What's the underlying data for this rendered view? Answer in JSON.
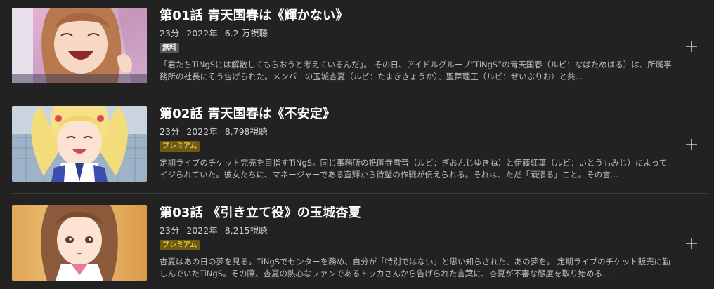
{
  "episodes": [
    {
      "title": "第01話 青天国春は《輝かない》",
      "duration": "23分",
      "year": "2022年",
      "views": "6.2 万視聴",
      "badge": "無料",
      "badge_type": "free",
      "description": "「君たちTiNgSには解散してもらおうと考えているんだ」。 その日、アイドルグループ”TiNgS”の青天国春（ルビ：なばためはる）は、所属事務所の社長にそう告げられた。メンバーの玉城杏夏（ルビ：たまききょうか）、聖舞理王（ルビ：せいぶりお）と共..."
    },
    {
      "title": "第02話 青天国春は《不安定》",
      "duration": "23分",
      "year": "2022年",
      "views": "8,798視聴",
      "badge": "プレミアム",
      "badge_type": "premium",
      "description": "定期ライブのチケット完売を目指すTiNgS。同じ事務所の祇園寺雪音（ルビ：ぎおんじゆきね）と伊藤紅葉（ルビ：いとうもみじ）によってイジられていた。彼女たちに、マネージャーである直輝から待望の作戦が伝えられる。それは、ただ「頑張る」こと。その言..."
    },
    {
      "title": "第03話 《引き立て役》の玉城杏夏",
      "duration": "23分",
      "year": "2022年",
      "views": "8,215視聴",
      "badge": "プレミアム",
      "badge_type": "premium",
      "description": "杏夏はあの日の夢を見る。TiNgSでセンターを務め、自分が「特別ではない」と思い知らされた、あの夢を。 定期ライブのチケット販売に勤しんでいたTiNgS。その際、杏夏の熱心なファンであるトッカさんから告げられた言葉に、杏夏が不審な態度を取り始める..."
    }
  ],
  "colors": {
    "background": "#222222",
    "premium_text": "#f2c230",
    "premium_bg": "#6b5a16",
    "free_bg": "#555555"
  },
  "icons": {
    "add": "plus-icon"
  }
}
